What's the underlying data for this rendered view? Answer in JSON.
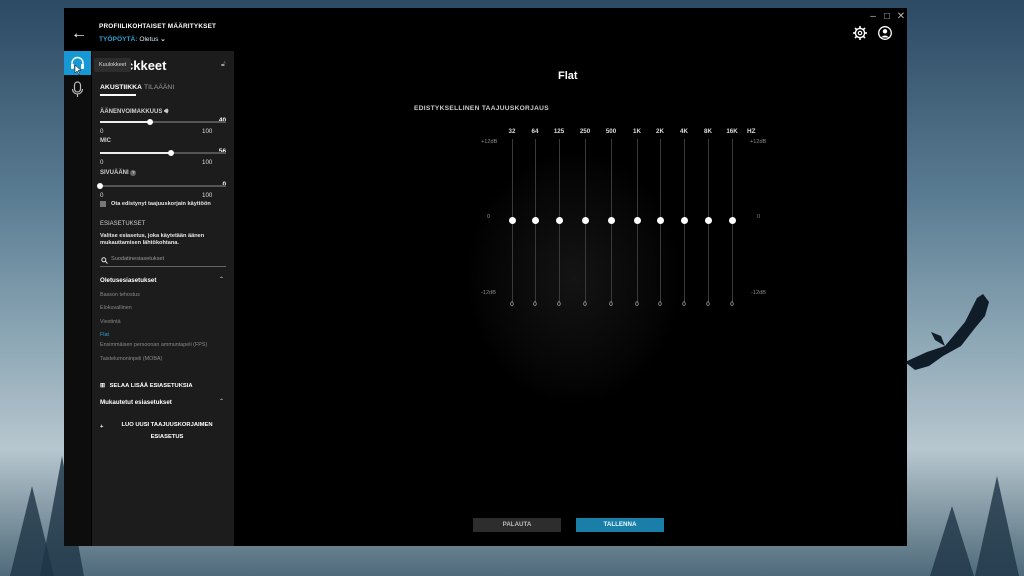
{
  "window": {
    "back_label": "←",
    "profile_settings_title": "PROFIILIKOHTAISET MÄÄRITYKSET",
    "profile_label": "TYÖPÖYTÄ:",
    "profile_value": "Oletus",
    "controls": {
      "minimize": "–",
      "maximize": "□",
      "close": "✕"
    }
  },
  "tooltip": "Kuulokkeet",
  "panel": {
    "title": "ckkeet",
    "tabs": [
      {
        "label": "AKUSTIIKKA",
        "active": true
      },
      {
        "label": "TILAÄÄNI",
        "active": false
      }
    ],
    "volume": {
      "label": "ÄÄNENVOIMAKKUUS",
      "value": "40",
      "min": "0",
      "max": "100",
      "level": 40
    },
    "mic": {
      "label": "MIC",
      "value": "56",
      "min": "0",
      "max": "100",
      "level": 56
    },
    "sidetone": {
      "label": "SIVUÄÄNI",
      "value": "0",
      "min": "0",
      "max": "100",
      "level": 0
    },
    "advanced_eq_checkbox": "Ota edistynyt taajuuskorjain käyttöön",
    "presets_heading": "ESIASETUKSET",
    "presets_description": "Valitse esiasetus, joka käytetään äänen mukauttamisen lähtökohtana.",
    "search_placeholder": "Suodatinesiasetukset",
    "default_presets_heading": "Oletusesiasetukset",
    "default_presets": [
      "Basson tehostus",
      "Elokuvallinen",
      "Viestintä",
      "Flat",
      "Ensimmäisen persoonan ammuntapeli (FPS)",
      "Taistelumoninpeli (MOBA)"
    ],
    "active_preset_index": 3,
    "browse_more": "SELAA LISÄÄ ESIASETUKSIA",
    "custom_presets_heading": "Mukautetut esiasetukset",
    "create_new": "LUO UUSI TAAJUUSKORJAIMEN ESIASETUS"
  },
  "equalizer": {
    "preset_name": "Flat",
    "heading": "EDISTYKSELLINEN TAAJUUSKORJAUS",
    "unit": "HZ",
    "scale_top": "+12dB",
    "scale_mid": "0",
    "scale_bottom": "-12dB",
    "bands": [
      {
        "freq": "32",
        "gain": "0"
      },
      {
        "freq": "64",
        "gain": "0"
      },
      {
        "freq": "125",
        "gain": "0"
      },
      {
        "freq": "250",
        "gain": "0"
      },
      {
        "freq": "500",
        "gain": "0"
      },
      {
        "freq": "1K",
        "gain": "0"
      },
      {
        "freq": "2K",
        "gain": "0"
      },
      {
        "freq": "4K",
        "gain": "0"
      },
      {
        "freq": "8K",
        "gain": "0"
      },
      {
        "freq": "16K",
        "gain": "0"
      }
    ]
  },
  "buttons": {
    "reset": "PALAUTA",
    "save": "TALLENNA"
  },
  "colors": {
    "accent": "#1598d3",
    "save_button": "#1a7fa8",
    "panel": "#1c1c1c"
  }
}
